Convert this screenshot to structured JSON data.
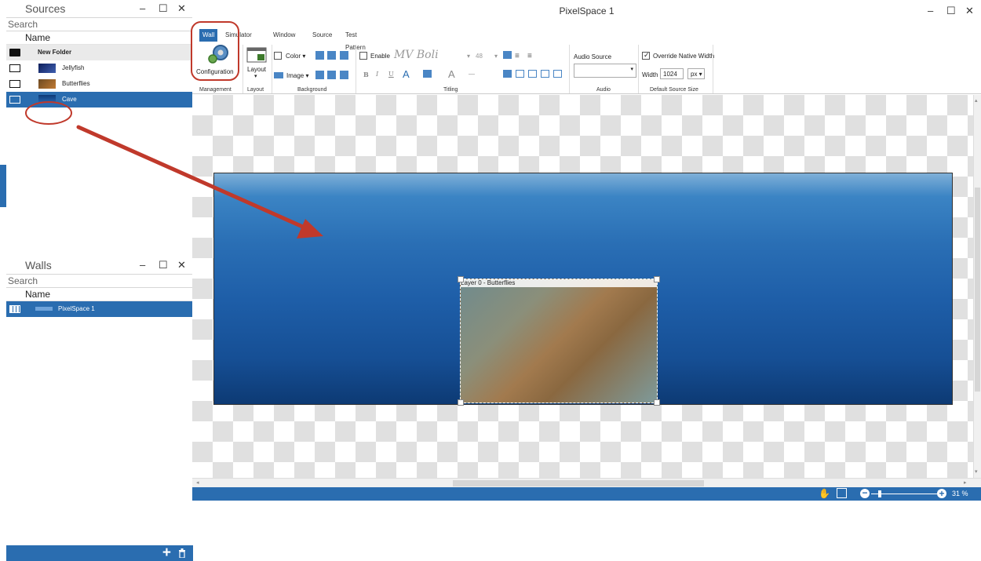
{
  "sources_panel": {
    "title": "Sources",
    "search_placeholder": "Search",
    "column_header": "Name",
    "items": [
      {
        "label": "New Folder"
      },
      {
        "label": "Jellyfish"
      },
      {
        "label": "Butterflies"
      },
      {
        "label": "Cave"
      }
    ]
  },
  "walls_panel": {
    "title": "Walls",
    "search_placeholder": "Search",
    "column_header": "Name",
    "items": [
      {
        "label": "PixelSpace 1"
      }
    ]
  },
  "window": {
    "title": "PixelSpace 1"
  },
  "ribbon": {
    "tabs": [
      "Wall",
      "Simulator",
      "Window",
      "Source",
      "Test Pattern"
    ],
    "configuration_label": "Configuration",
    "layout_label": "Layout",
    "color_label": "Color",
    "image_label": "Image",
    "enable_label": "Enable",
    "font_name": "MV Boli",
    "font_size": "48",
    "audio_source_label": "Audio Source",
    "override_label": "Override Native Width",
    "width_label": "Width",
    "width_value": "1024",
    "width_unit": "px",
    "groups": [
      "Management",
      "Layout",
      "Background",
      "Titling",
      "Audio",
      "Default Source Size"
    ]
  },
  "canvas": {
    "layer_label": "Layer 0 - Butterflies"
  },
  "status": {
    "zoom": "31 %"
  },
  "colors": {
    "accent": "#2a6db0",
    "annotation": "#c0392b"
  }
}
